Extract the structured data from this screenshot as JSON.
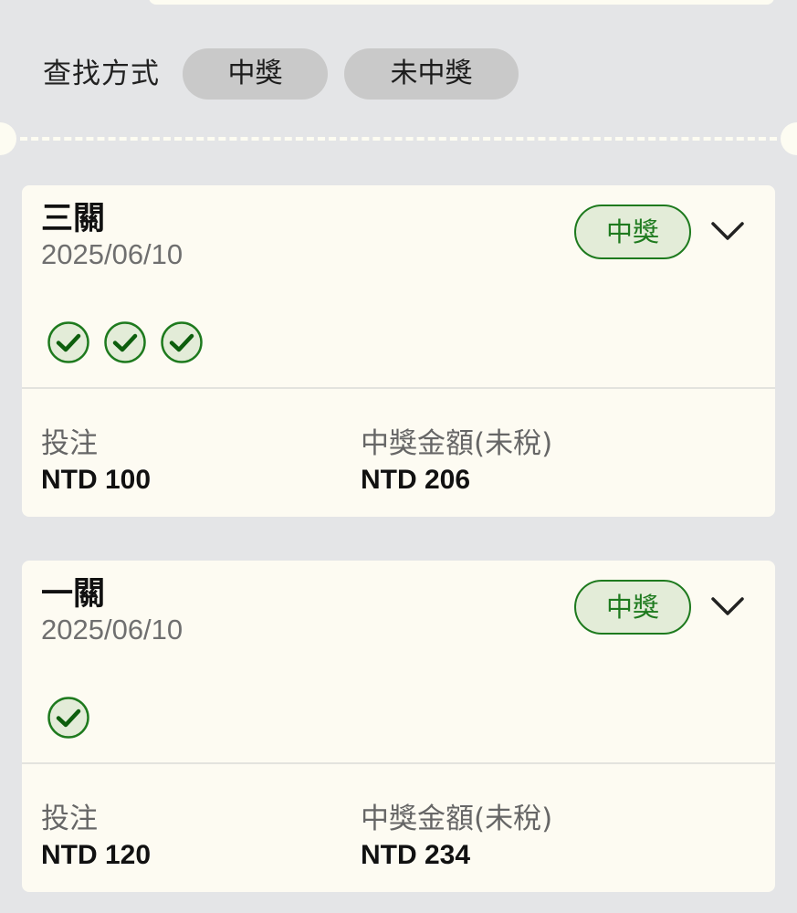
{
  "filter": {
    "label": "查找方式",
    "chips": [
      "中獎",
      "未中獎"
    ]
  },
  "cards": [
    {
      "title": "三關",
      "date": "2025/06/10",
      "status": "中獎",
      "check_count": 3,
      "bet_label": "投注",
      "bet_value": "NTD 100",
      "win_label": "中獎金額(未稅)",
      "win_value": "NTD 206"
    },
    {
      "title": "一關",
      "date": "2025/06/10",
      "status": "中獎",
      "check_count": 1,
      "bet_label": "投注",
      "bet_value": "NTD 120",
      "win_label": "中獎金額(未稅)",
      "win_value": "NTD 234"
    }
  ],
  "colors": {
    "page_bg": "#e4e5e7",
    "card_bg": "#fdfbf2",
    "accent_green": "#1e7a1e",
    "badge_bg": "#e3ecd8",
    "chip_bg": "#c9c9c9"
  },
  "icons": {
    "check": "check-circle-icon",
    "expand": "chevron-down-icon"
  }
}
